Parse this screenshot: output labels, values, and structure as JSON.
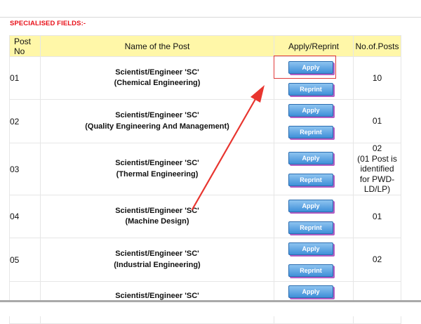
{
  "section_title": "SPECIALISED FIELDS:-",
  "table": {
    "headers": {
      "post_no": "Post No",
      "name": "Name of the Post",
      "apply": "Apply/Reprint",
      "count": "No.of.Posts"
    },
    "rows": [
      {
        "no": "01",
        "title": "Scientist/Engineer 'SC'",
        "field": "(Chemical Engineering)",
        "apply": "Apply",
        "reprint": "Reprint",
        "count": "10"
      },
      {
        "no": "02",
        "title": "Scientist/Engineer 'SC'",
        "field": "(Quality Engineering And Management)",
        "apply": "Apply",
        "reprint": "Reprint",
        "count": "01"
      },
      {
        "no": "03",
        "title": "Scientist/Engineer 'SC'",
        "field": "(Thermal Engineering)",
        "apply": "Apply",
        "reprint": "Reprint",
        "count": "02",
        "count_note": "(01 Post is identified for PWD-LD/LP)"
      },
      {
        "no": "04",
        "title": "Scientist/Engineer 'SC'",
        "field": "(Machine Design)",
        "apply": "Apply",
        "reprint": "Reprint",
        "count": "01"
      },
      {
        "no": "05",
        "title": "Scientist/Engineer 'SC'",
        "field": "(Industrial Engineering)",
        "apply": "Apply",
        "reprint": "Reprint",
        "count": "02"
      },
      {
        "no": "",
        "title": "Scientist/Engineer 'SC'",
        "field": "",
        "apply": "Apply",
        "reprint": "",
        "count": ""
      }
    ]
  },
  "annotation": {
    "highlight_color": "#e03a3a",
    "arrow_color": "#e8352f"
  }
}
